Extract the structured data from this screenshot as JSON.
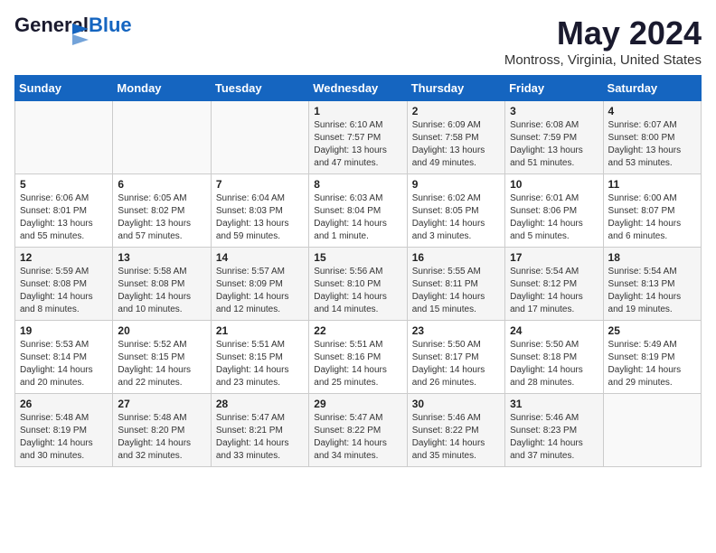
{
  "header": {
    "logo_general": "General",
    "logo_blue": "Blue",
    "month_title": "May 2024",
    "location": "Montross, Virginia, United States"
  },
  "weekdays": [
    "Sunday",
    "Monday",
    "Tuesday",
    "Wednesday",
    "Thursday",
    "Friday",
    "Saturday"
  ],
  "weeks": [
    [
      {
        "day": "",
        "info": ""
      },
      {
        "day": "",
        "info": ""
      },
      {
        "day": "",
        "info": ""
      },
      {
        "day": "1",
        "info": "Sunrise: 6:10 AM\nSunset: 7:57 PM\nDaylight: 13 hours and 47 minutes."
      },
      {
        "day": "2",
        "info": "Sunrise: 6:09 AM\nSunset: 7:58 PM\nDaylight: 13 hours and 49 minutes."
      },
      {
        "day": "3",
        "info": "Sunrise: 6:08 AM\nSunset: 7:59 PM\nDaylight: 13 hours and 51 minutes."
      },
      {
        "day": "4",
        "info": "Sunrise: 6:07 AM\nSunset: 8:00 PM\nDaylight: 13 hours and 53 minutes."
      }
    ],
    [
      {
        "day": "5",
        "info": "Sunrise: 6:06 AM\nSunset: 8:01 PM\nDaylight: 13 hours and 55 minutes."
      },
      {
        "day": "6",
        "info": "Sunrise: 6:05 AM\nSunset: 8:02 PM\nDaylight: 13 hours and 57 minutes."
      },
      {
        "day": "7",
        "info": "Sunrise: 6:04 AM\nSunset: 8:03 PM\nDaylight: 13 hours and 59 minutes."
      },
      {
        "day": "8",
        "info": "Sunrise: 6:03 AM\nSunset: 8:04 PM\nDaylight: 14 hours and 1 minute."
      },
      {
        "day": "9",
        "info": "Sunrise: 6:02 AM\nSunset: 8:05 PM\nDaylight: 14 hours and 3 minutes."
      },
      {
        "day": "10",
        "info": "Sunrise: 6:01 AM\nSunset: 8:06 PM\nDaylight: 14 hours and 5 minutes."
      },
      {
        "day": "11",
        "info": "Sunrise: 6:00 AM\nSunset: 8:07 PM\nDaylight: 14 hours and 6 minutes."
      }
    ],
    [
      {
        "day": "12",
        "info": "Sunrise: 5:59 AM\nSunset: 8:08 PM\nDaylight: 14 hours and 8 minutes."
      },
      {
        "day": "13",
        "info": "Sunrise: 5:58 AM\nSunset: 8:08 PM\nDaylight: 14 hours and 10 minutes."
      },
      {
        "day": "14",
        "info": "Sunrise: 5:57 AM\nSunset: 8:09 PM\nDaylight: 14 hours and 12 minutes."
      },
      {
        "day": "15",
        "info": "Sunrise: 5:56 AM\nSunset: 8:10 PM\nDaylight: 14 hours and 14 minutes."
      },
      {
        "day": "16",
        "info": "Sunrise: 5:55 AM\nSunset: 8:11 PM\nDaylight: 14 hours and 15 minutes."
      },
      {
        "day": "17",
        "info": "Sunrise: 5:54 AM\nSunset: 8:12 PM\nDaylight: 14 hours and 17 minutes."
      },
      {
        "day": "18",
        "info": "Sunrise: 5:54 AM\nSunset: 8:13 PM\nDaylight: 14 hours and 19 minutes."
      }
    ],
    [
      {
        "day": "19",
        "info": "Sunrise: 5:53 AM\nSunset: 8:14 PM\nDaylight: 14 hours and 20 minutes."
      },
      {
        "day": "20",
        "info": "Sunrise: 5:52 AM\nSunset: 8:15 PM\nDaylight: 14 hours and 22 minutes."
      },
      {
        "day": "21",
        "info": "Sunrise: 5:51 AM\nSunset: 8:15 PM\nDaylight: 14 hours and 23 minutes."
      },
      {
        "day": "22",
        "info": "Sunrise: 5:51 AM\nSunset: 8:16 PM\nDaylight: 14 hours and 25 minutes."
      },
      {
        "day": "23",
        "info": "Sunrise: 5:50 AM\nSunset: 8:17 PM\nDaylight: 14 hours and 26 minutes."
      },
      {
        "day": "24",
        "info": "Sunrise: 5:50 AM\nSunset: 8:18 PM\nDaylight: 14 hours and 28 minutes."
      },
      {
        "day": "25",
        "info": "Sunrise: 5:49 AM\nSunset: 8:19 PM\nDaylight: 14 hours and 29 minutes."
      }
    ],
    [
      {
        "day": "26",
        "info": "Sunrise: 5:48 AM\nSunset: 8:19 PM\nDaylight: 14 hours and 30 minutes."
      },
      {
        "day": "27",
        "info": "Sunrise: 5:48 AM\nSunset: 8:20 PM\nDaylight: 14 hours and 32 minutes."
      },
      {
        "day": "28",
        "info": "Sunrise: 5:47 AM\nSunset: 8:21 PM\nDaylight: 14 hours and 33 minutes."
      },
      {
        "day": "29",
        "info": "Sunrise: 5:47 AM\nSunset: 8:22 PM\nDaylight: 14 hours and 34 minutes."
      },
      {
        "day": "30",
        "info": "Sunrise: 5:46 AM\nSunset: 8:22 PM\nDaylight: 14 hours and 35 minutes."
      },
      {
        "day": "31",
        "info": "Sunrise: 5:46 AM\nSunset: 8:23 PM\nDaylight: 14 hours and 37 minutes."
      },
      {
        "day": "",
        "info": ""
      }
    ]
  ]
}
